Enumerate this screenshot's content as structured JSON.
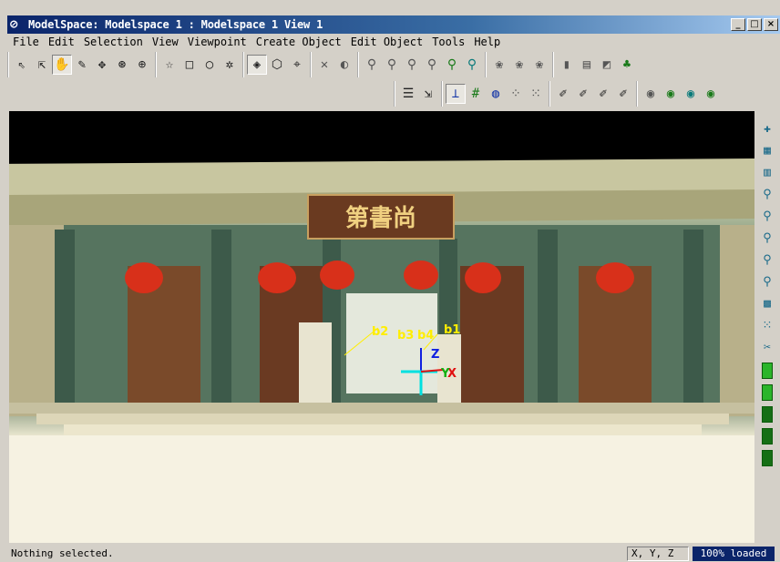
{
  "window": {
    "title": "ModelSpace: Modelspace 1 : Modelspace 1 View 1",
    "app_icon": "cyclone-logo-icon",
    "buttons": [
      "_",
      "□",
      "×"
    ]
  },
  "menu": [
    "File",
    "Edit",
    "Selection",
    "View",
    "Viewpoint",
    "Create Object",
    "Edit Object",
    "Tools",
    "Help"
  ],
  "toolbar": {
    "row1_icons": [
      "select-arrow-icon",
      "select-plus-icon",
      "pan-hand-icon",
      "pencil-icon",
      "move-cross-icon",
      "rotate-icon",
      "zoom-icon",
      "fence-polygon-icon",
      "fence-rectangle-icon",
      "fence-circle-icon",
      "fence-star-icon",
      "render-solid-icon",
      "render-wire-icon",
      "viewpoint-icon",
      "point-tool-1-icon",
      "point-tool-2-icon",
      "fit-1-icon",
      "fit-2-icon",
      "fit-3-icon",
      "fit-4-icon",
      "fit-5-icon",
      "fit-6-icon",
      "object-1-icon",
      "object-2-icon",
      "object-3-icon",
      "object-4-icon",
      "object-5-icon",
      "object-6-icon",
      "object-7-icon"
    ],
    "row2_icons": [
      "layers-icon",
      "cursor-icon",
      "axes-icon",
      "grid-icon",
      "globe-icon",
      "points-1-icon",
      "points-2-icon",
      "brush-1-icon",
      "brush-2-icon",
      "brush-3-icon",
      "brush-4-icon",
      "color-1-icon",
      "color-2-icon",
      "color-3-icon",
      "color-4-icon"
    ]
  },
  "scene": {
    "sign_text": "第書尚",
    "labels": [
      "b2",
      "b3",
      "b4",
      "b1"
    ],
    "axis_labels": {
      "z": "Z",
      "x": "X",
      "y": "Y"
    },
    "colors": {
      "label": "#ffee00",
      "axis_x": "#e01010",
      "axis_y": "#10b010",
      "axis_z": "#1020e0",
      "axis_cyan": "#00e0e0"
    }
  },
  "right_strip": {
    "icons": [
      "add-point-icon",
      "colorize-icon",
      "grayscale-icon",
      "fit-pipe-icon",
      "fit-surface-icon",
      "fit-cylinder-icon",
      "fit-plane-icon",
      "fit-sphere-icon",
      "mesh-icon",
      "points-grid-icon",
      "cut-plane-icon"
    ],
    "bars": 5
  },
  "status": {
    "message": "Nothing selected.",
    "coords": "X, Y, Z",
    "loaded": "100% loaded"
  }
}
